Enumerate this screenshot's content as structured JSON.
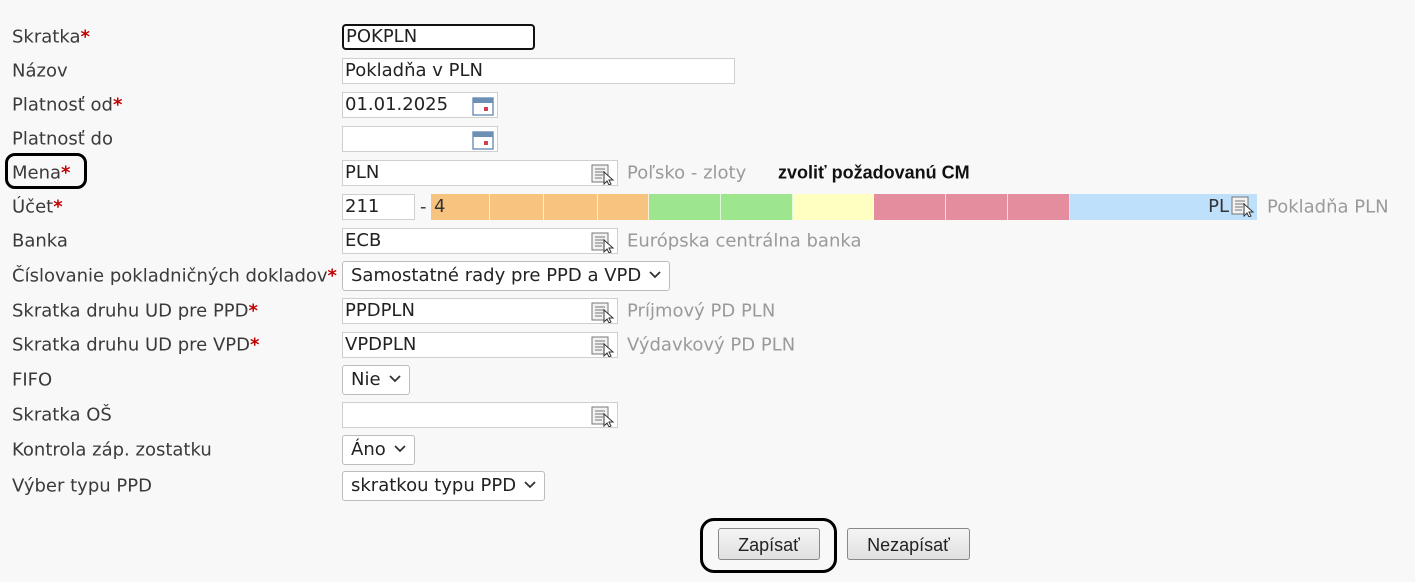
{
  "form": {
    "skratka": {
      "label": "Skratka",
      "required_mark": "*",
      "value": "POKPLN"
    },
    "nazov": {
      "label": "Názov",
      "value": "Pokladňa v PLN"
    },
    "platnost_od": {
      "label": "Platnosť od",
      "required_mark": "*",
      "value": "01.01.2025"
    },
    "platnost_do": {
      "label": "Platnosť do",
      "value": ""
    },
    "mena": {
      "label": "Mena",
      "required_mark": "*",
      "value": "PLN",
      "hint": "Poľsko - zloty",
      "note": "zvoliť požadovanú CM"
    },
    "ucet": {
      "label": "Účet",
      "required_mark": "*",
      "prefix": "211",
      "separator": "-",
      "first_segment": "4",
      "last_segment": "PL",
      "hint": "Pokladňa PLN"
    },
    "banka": {
      "label": "Banka",
      "value": "ECB",
      "hint": "Európska centrálna banka"
    },
    "cislovanie": {
      "label": "Číslovanie pokladničných dokladov",
      "required_mark": "*",
      "value": "Samostatné rady pre PPD a VPD"
    },
    "ud_ppd": {
      "label": "Skratka druhu UD pre PPD",
      "required_mark": "*",
      "value": "PPDPLN",
      "hint": "Príjmový PD PLN"
    },
    "ud_vpd": {
      "label": "Skratka druhu UD pre VPD",
      "required_mark": "*",
      "value": "VPDPLN",
      "hint": "Výdavkový PD PLN"
    },
    "fifo": {
      "label": "FIFO",
      "value": "Nie"
    },
    "skratka_os": {
      "label": "Skratka OŠ",
      "value": ""
    },
    "kontrola": {
      "label": "Kontrola záp. zostatku",
      "value": "Áno"
    },
    "vyber": {
      "label": "Výber typu PPD",
      "value": "skratkou typu PPD"
    }
  },
  "buttons": {
    "save": "Zapísať",
    "cancel": "Nezapísať"
  },
  "colors": {
    "required": "#c00000",
    "segment_orange": "#f7c47f",
    "segment_green": "#9ee68e",
    "segment_yellow": "#ffffc2",
    "segment_pink": "#e38d9f",
    "segment_blue": "#bfe0fb"
  },
  "icons": {
    "lookup": "lookup-list-icon",
    "calendar": "calendar-icon",
    "dropdown": "chevron-down-icon"
  }
}
